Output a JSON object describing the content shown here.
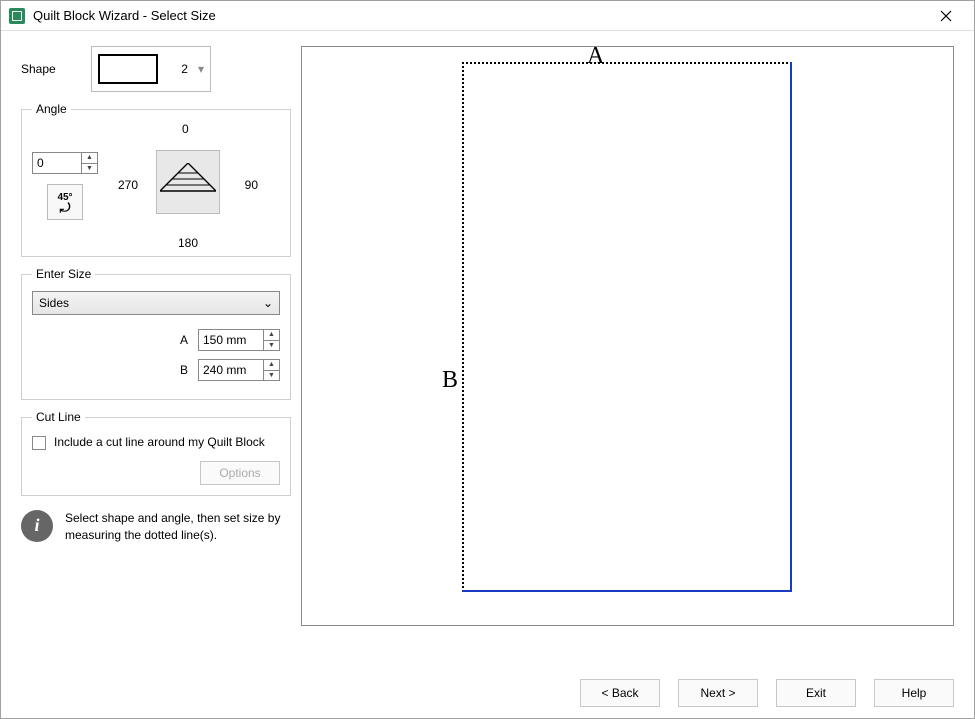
{
  "window": {
    "title": "Quilt Block Wizard - Select Size"
  },
  "shape": {
    "label": "Shape",
    "count": "2"
  },
  "angle": {
    "legend": "Angle",
    "value": "0",
    "btn45": "45°",
    "north": "0",
    "east": "90",
    "south": "180",
    "west": "270"
  },
  "size": {
    "legend": "Enter Size",
    "mode": "Sides",
    "rows": [
      {
        "label": "A",
        "value": "150 mm"
      },
      {
        "label": "B",
        "value": "240 mm"
      }
    ]
  },
  "cutline": {
    "legend": "Cut Line",
    "label": "Include a cut line around my Quilt Block",
    "options": "Options"
  },
  "info": {
    "text": "Select shape and angle, then set size by measuring the dotted line(s)."
  },
  "preview": {
    "labelA": "A",
    "labelB": "B"
  },
  "footer": {
    "back": "< Back",
    "next": "Next >",
    "exit": "Exit",
    "help": "Help"
  }
}
